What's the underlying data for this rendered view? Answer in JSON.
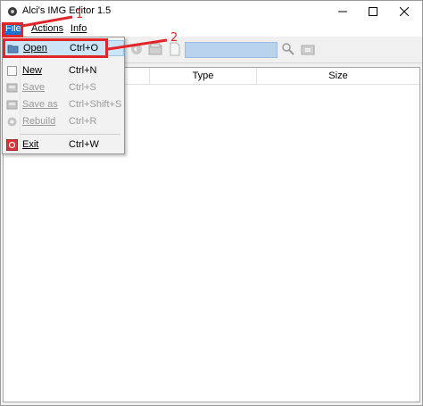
{
  "window": {
    "title": "Alci's IMG Editor 1.5",
    "controls": {
      "minimize": "—",
      "maximize": "☐",
      "close": "✕"
    }
  },
  "menubar": {
    "file": "File",
    "actions": "Actions",
    "info": "Info"
  },
  "file_menu": {
    "items": [
      {
        "label": "Open",
        "shortcut": "Ctrl+O",
        "enabled": true,
        "icon": "folder-open-icon"
      },
      {
        "label": "New",
        "shortcut": "Ctrl+N",
        "enabled": true,
        "icon": "new-file-icon"
      },
      {
        "label": "Save",
        "shortcut": "Ctrl+S",
        "enabled": false,
        "icon": "save-icon"
      },
      {
        "label": "Save as",
        "shortcut": "Ctrl+Shift+S",
        "enabled": false,
        "icon": "save-as-icon"
      },
      {
        "label": "Rebuild",
        "shortcut": "Ctrl+R",
        "enabled": false,
        "icon": "rebuild-gear-icon"
      },
      {
        "label": "Exit",
        "shortcut": "Ctrl+W",
        "enabled": true,
        "icon": "exit-icon"
      }
    ]
  },
  "list": {
    "columns": [
      "",
      "Type",
      "Size"
    ]
  },
  "annotations": {
    "step1": "1",
    "step2": "2",
    "color": "#e0262b"
  },
  "colors": {
    "menu_highlight": "#1f6fd1",
    "item_hover": "#cce4f7",
    "search_field": "#b9d3ee"
  }
}
